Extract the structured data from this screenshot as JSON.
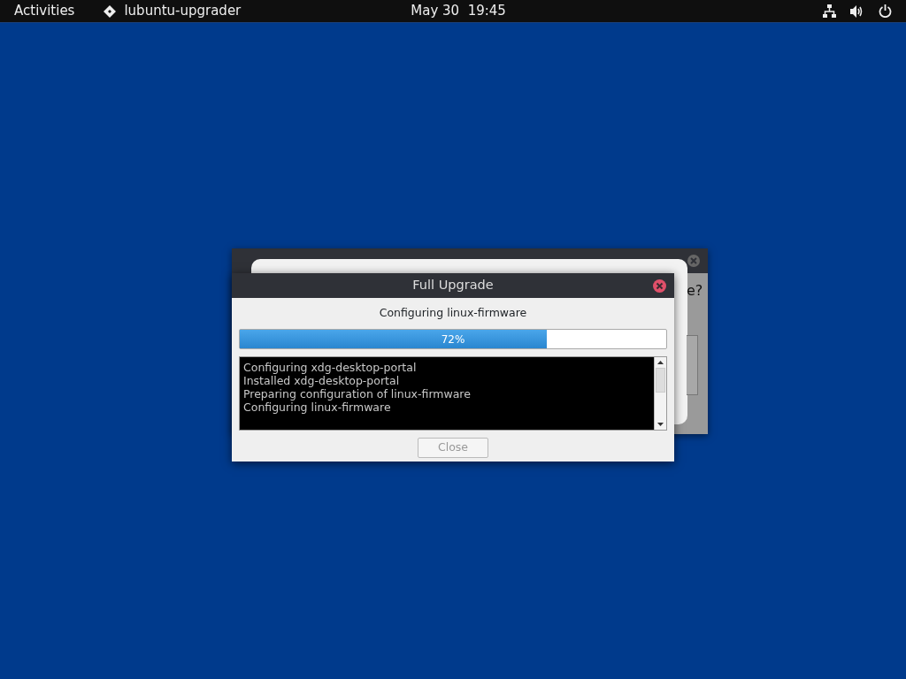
{
  "top_bar": {
    "activities": "Activities",
    "app_name": "lubuntu-upgrader",
    "clock": "May 30  19:45"
  },
  "background_window": {
    "text_fragment": "e?"
  },
  "dialog": {
    "title": "Full Upgrade",
    "status": "Configuring linux-firmware",
    "progress": {
      "level": 0.72,
      "reading": "72%"
    },
    "log": [
      "Configuring xdg-desktop-portal",
      "Installed xdg-desktop-portal",
      "Preparing configuration of linux-firmware",
      "Configuring linux-firmware"
    ],
    "close_button": {
      "label": "Close",
      "disabled": true
    }
  }
}
